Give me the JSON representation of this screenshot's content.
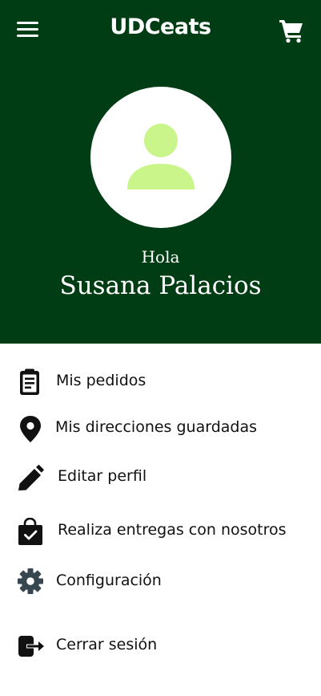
{
  "header": {
    "title": "UDCeats",
    "menu_icon": "hamburger-menu-icon",
    "cart_icon": "cart-icon",
    "background_color": "#003d14"
  },
  "profile": {
    "avatar_icon": "user-icon",
    "avatar_icon_color": "#c9f58a",
    "greeting": "Hola",
    "name": "Susana Palacios"
  },
  "menu": {
    "items": [
      {
        "label": "Mis pedidos",
        "icon": "clipboard-icon"
      },
      {
        "label": "Mis direcciones guardadas",
        "icon": "location-pin-icon"
      },
      {
        "label": "Editar perfil",
        "icon": "pencil-icon"
      },
      {
        "label": "Realiza entregas con nosotros",
        "icon": "shopping-bag-check-icon"
      },
      {
        "label": "Configuración",
        "icon": "gear-icon",
        "icon_color": "#37474f"
      },
      {
        "label": "Cerrar sesión",
        "icon": "logout-icon"
      }
    ]
  }
}
